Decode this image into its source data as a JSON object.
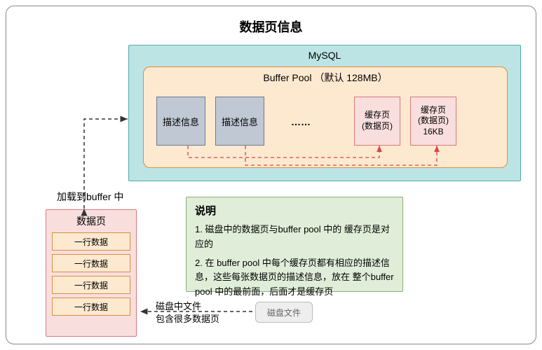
{
  "title": "数据页信息",
  "mysql": {
    "label": "MySQL"
  },
  "buffer_pool": {
    "label": "Buffer Pool （默认 128MB）",
    "desc1": "描述信息",
    "desc2": "描述信息",
    "dots": "……",
    "cache1": "缓存页\n(数据页)",
    "cache2": "缓存页\n(数据页)\n16KB"
  },
  "load_label": "加载到buffer 中",
  "datapage": {
    "title": "数据页",
    "rows": [
      "一行数据",
      "一行数据",
      "一行数据",
      "一行数据"
    ]
  },
  "note": {
    "title": "说明",
    "p1": "1. 磁盘中的数据页与buffer pool 中的 缓存页是对应的",
    "p2": "2. 在 buffer pool 中每个缓存页都有相应的描述信息，这些每张数据页的描述信息，放在 整个buffer pool 中的最前面，后面才是缓存页"
  },
  "disk": {
    "file_label": "磁盘文件",
    "text": "磁盘中文件\n包含很多数据页"
  }
}
